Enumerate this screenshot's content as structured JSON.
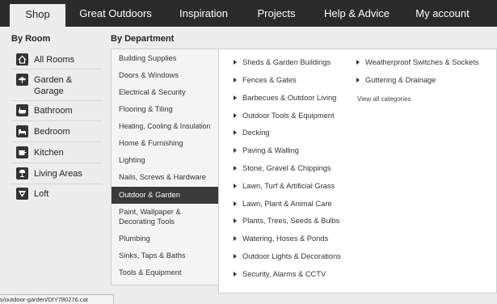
{
  "nav": {
    "tabs": [
      "Shop",
      "Great Outdoors",
      "Inspiration",
      "Projects",
      "Help & Advice",
      "My account"
    ]
  },
  "rooms": {
    "heading": "By Room",
    "items": [
      {
        "label": "All Rooms",
        "icon": "home-icon"
      },
      {
        "label": "Garden &\nGarage",
        "icon": "garden-icon"
      },
      {
        "label": "Bathroom",
        "icon": "bathroom-icon"
      },
      {
        "label": "Bedroom",
        "icon": "bed-icon"
      },
      {
        "label": "Kitchen",
        "icon": "kitchen-icon"
      },
      {
        "label": "Living Areas",
        "icon": "lamp-icon"
      },
      {
        "label": "Loft",
        "icon": "loft-icon"
      }
    ]
  },
  "departments": {
    "heading": "By Department",
    "items": [
      "Building Supplies",
      "Doors & Windows",
      "Electrical & Security",
      "Flooring & Tiling",
      "Heating, Cooling & Insulation",
      "Home & Furnishing",
      "Lighting",
      "Nails, Screws & Hardware",
      "Outdoor & Garden",
      "Paint, Wallpaper &\nDecorating Tools",
      "Plumbing",
      "Sinks, Taps & Baths",
      "Tools & Equipment"
    ],
    "active": "Outdoor & Garden"
  },
  "categories": {
    "col1": [
      "Sheds & Garden Buildings",
      "Fences & Gates",
      "Barbecues & Outdoor Living",
      "Outdoor Tools & Equipment",
      "Decking",
      "Paving & Walling",
      "Stone, Gravel & Chippings",
      "Lawn, Turf & Artificial Grass",
      "Lawn, Plant & Animal Care",
      "Plants, Trees, Seeds & Bulbs",
      "Watering, Hoses & Ponds",
      "Outdoor Lights & Decorations",
      "Security, Alarms & CCTV"
    ],
    "col2": [
      "Weatherproof Switches & Sockets",
      "Guttering & Drainage"
    ],
    "view_all": "View all categories"
  },
  "status_url": "s/outdoor-garden/DIY780276.cat"
}
